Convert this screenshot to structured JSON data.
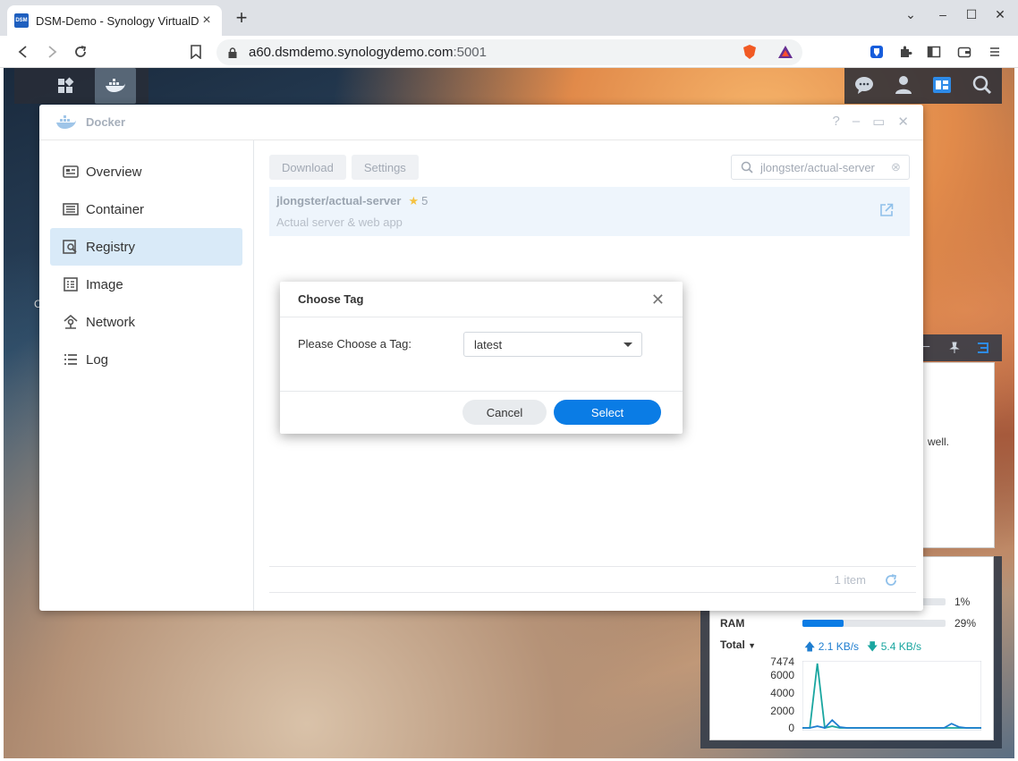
{
  "browser": {
    "tab_title": "DSM-Demo - Synology VirtualD",
    "favicon_text": "DSM",
    "url_host": "a60.dsmdemo.synologydemo.com",
    "url_port": ":5001"
  },
  "window": {
    "title": "Docker",
    "help": "?"
  },
  "sidebar": {
    "items": [
      {
        "label": "Overview",
        "icon": "overview-icon"
      },
      {
        "label": "Container",
        "icon": "container-icon"
      },
      {
        "label": "Registry",
        "icon": "registry-icon",
        "selected": true
      },
      {
        "label": "Image",
        "icon": "image-icon"
      },
      {
        "label": "Network",
        "icon": "network-icon"
      },
      {
        "label": "Log",
        "icon": "log-icon"
      }
    ]
  },
  "toolbar": {
    "download_label": "Download",
    "settings_label": "Settings",
    "search_value": "jlongster/actual-server"
  },
  "result": {
    "name": "jlongster/actual-server",
    "stars": "5",
    "description": "Actual server & web app"
  },
  "footer": {
    "count": "1 item"
  },
  "dialog": {
    "title": "Choose Tag",
    "label": "Please Choose a Tag:",
    "selected_tag": "latest",
    "cancel_label": "Cancel",
    "select_label": "Select"
  },
  "widgets": {
    "partial_text": "well.",
    "edge_letter": "C",
    "cpu_pct": "1%",
    "cpu_fraction": 0.01,
    "ram_label": "RAM",
    "ram_pct": "29%",
    "ram_fraction": 0.29,
    "total_label": "Total",
    "net_up": "2.1 KB/s",
    "net_down": "5.4 KB/s",
    "y_ticks": [
      "7474",
      "6000",
      "4000",
      "2000",
      "0"
    ]
  },
  "colors": {
    "accent": "#0a7ce5",
    "selected_nav": "#d9eaf8",
    "net_up": "#1f7ed0",
    "net_down": "#1aa6a0"
  },
  "chart_data": {
    "type": "line",
    "ylim": [
      0,
      7474
    ],
    "series": [
      {
        "color": "#1aa6a0",
        "values": [
          0,
          0,
          7474,
          0,
          200,
          0,
          0,
          0,
          0,
          0,
          0,
          0,
          0,
          0,
          0,
          0,
          0,
          0,
          0,
          0,
          0,
          0,
          0,
          0,
          0
        ]
      },
      {
        "color": "#1f7ed0",
        "values": [
          0,
          0,
          200,
          0,
          900,
          100,
          0,
          0,
          0,
          0,
          0,
          0,
          0,
          0,
          0,
          0,
          0,
          0,
          0,
          0,
          500,
          100,
          0,
          0,
          0
        ]
      }
    ]
  }
}
